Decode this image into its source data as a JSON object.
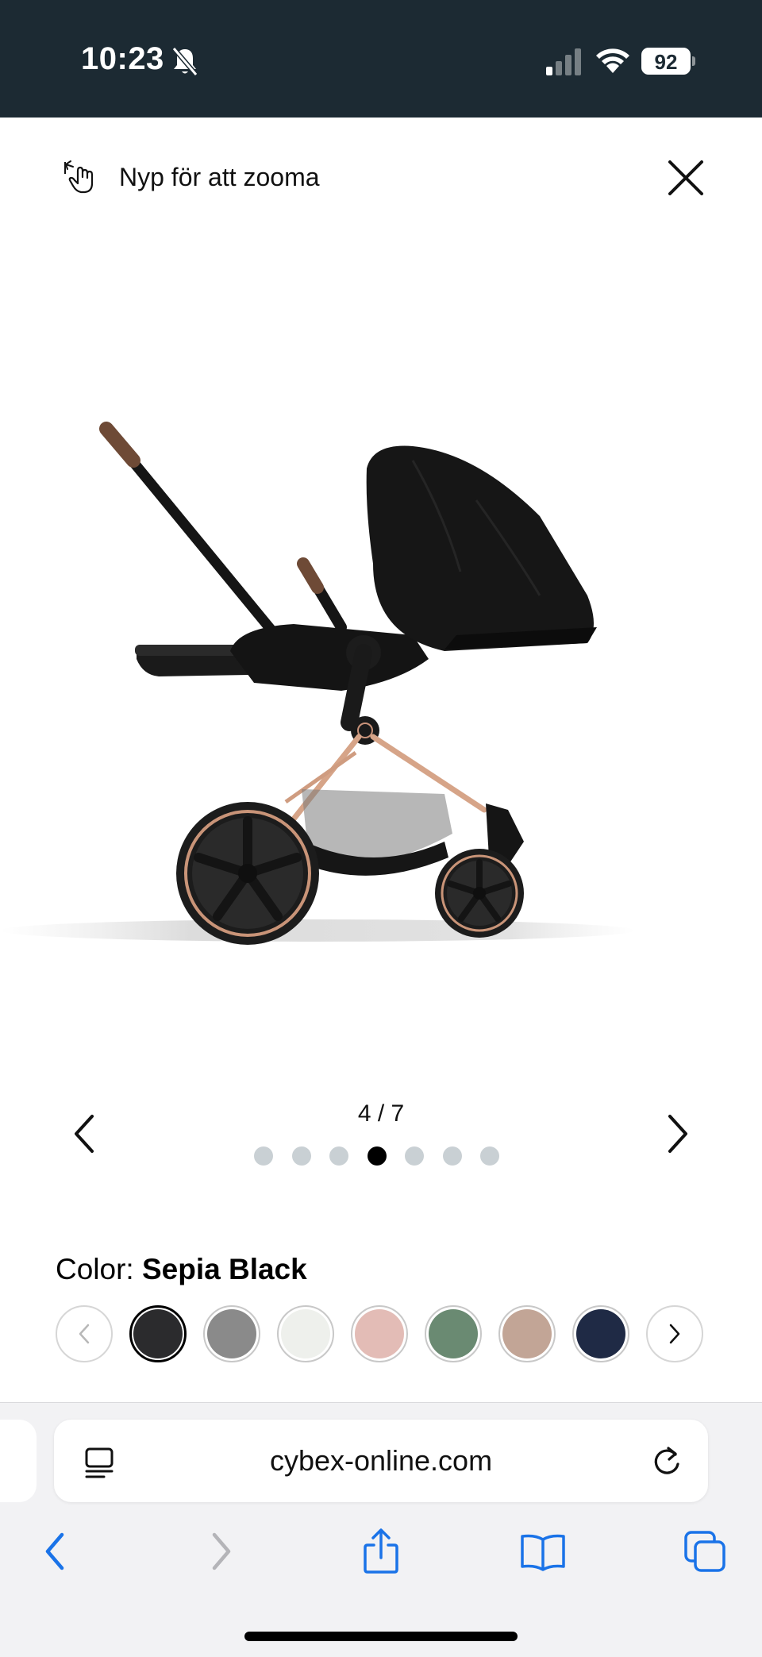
{
  "status_bar": {
    "time": "10:23",
    "battery": "92",
    "icons": [
      "bell-slash-icon",
      "cellular-signal-icon",
      "wifi-icon",
      "battery-icon"
    ]
  },
  "zoom_header": {
    "hint": "Nyp för att zooma",
    "icons": [
      "pinch-zoom-icon",
      "close-icon"
    ]
  },
  "gallery": {
    "counter": "4 / 7",
    "total": 7,
    "current": 4,
    "prev_icon": "chevron-left-icon",
    "next_icon": "chevron-right-icon"
  },
  "color_selector": {
    "label": "Color:",
    "selected_name": "Sepia Black",
    "swatches": [
      {
        "color": "#2b2b2d",
        "selected": true
      },
      {
        "color": "#8a8a8a",
        "selected": false
      },
      {
        "color": "#eef0ec",
        "selected": false
      },
      {
        "color": "#e3bcb6",
        "selected": false
      },
      {
        "color": "#6a8a72",
        "selected": false
      },
      {
        "color": "#c2a596",
        "selected": false
      },
      {
        "color": "#1f2a45",
        "selected": false
      }
    ]
  },
  "browser": {
    "url": "cybex-online.com",
    "accent_color": "#1a73e8",
    "toolbar_icons": [
      "back-icon",
      "forward-icon",
      "share-icon",
      "bookmarks-icon",
      "tabs-icon"
    ]
  }
}
